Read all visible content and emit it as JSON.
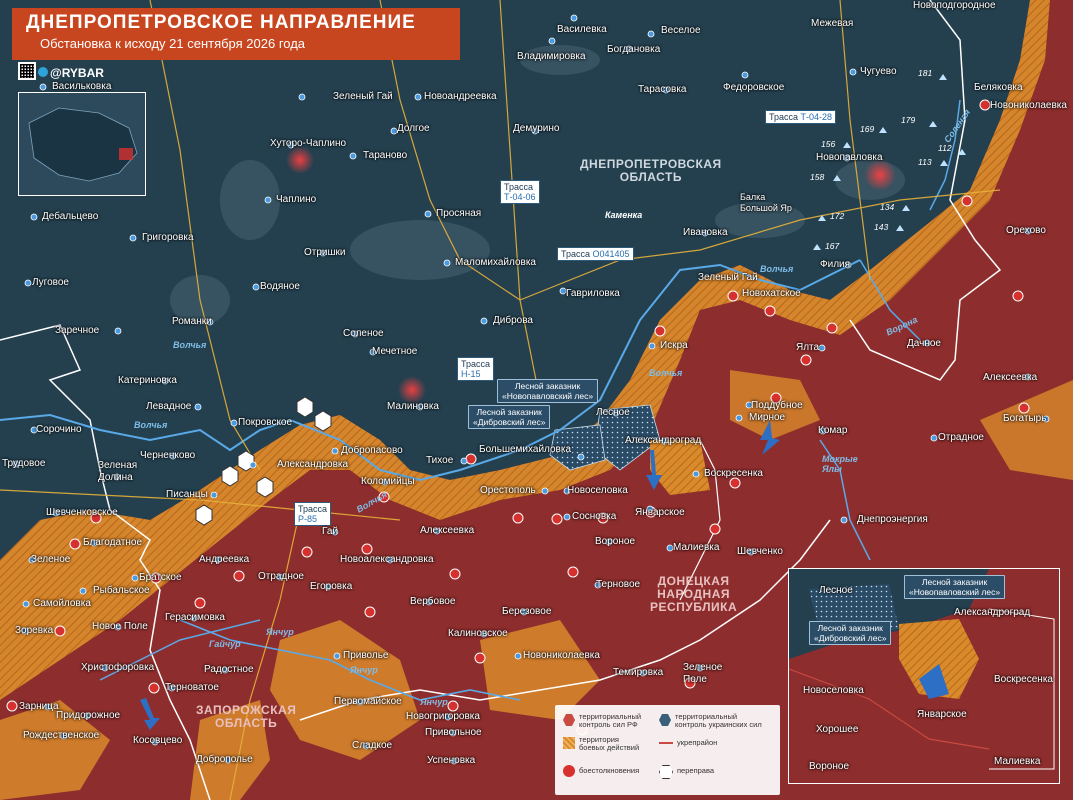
{
  "header": {
    "title": "ДНЕПРОПЕТРОВСКОЕ НАПРАВЛЕНИЕ",
    "subtitle": "Обстановка к исходу 21 сентября 2026 года",
    "brand": "@RYBAR"
  },
  "colors": {
    "russian_control": "#8e2d2d",
    "combat_zone": "#d98a2b",
    "ukrainian_control": "#1f3a4a",
    "front_line": "#ffffff",
    "clash": "#d32d2d"
  },
  "regions": {
    "dnepr": "ДНЕПРОПЕТРОВСКАЯ\nОБЛАСТЬ",
    "donetsk": "ДОНЕЦКАЯ\nНАРОДНАЯ\nРЕСПУБЛИКА",
    "zaporozhye": "ЗАПОРОЖСКАЯ\nОБЛАСТЬ"
  },
  "roads": {
    "t0428_prefix": "Трасса ",
    "t0428": "Т-04-28",
    "t0406_prefix": "Трасса",
    "t0406": "Т-04-06",
    "o041405_prefix": "Трасса ",
    "o041405": "О041405",
    "h15_prefix": "Трасса",
    "h15": "Н-15",
    "p85_prefix": "Трасса",
    "p85": "Р-85"
  },
  "rivers": {
    "volchya1": "Волчья",
    "volchya2": "Волчья",
    "volchya3": "Волчья",
    "volchya4": "Волчья",
    "volchya5": "Волчья",
    "yanchur1": "Янчур",
    "yanchur2": "Янчур",
    "yanchur3": "Янчур",
    "gaichur": "Гайчур",
    "vornaya": "Ворона",
    "solenaya": "Соленая",
    "mokrye_yaly": "Мокрые\nЯлы",
    "kamenka": "Каменка"
  },
  "towns": {
    "novopodgorodnoe": "Новоподгородное",
    "mezhevaya": "Межевая",
    "vasilevka_n": "Василевка",
    "veseloe": "Веселое",
    "vladimirovka": "Владимировка",
    "bogdanovka": "Богдановка",
    "vasilkovka": "Васильковка",
    "chuguevo": "Чугуево",
    "belyakovka": "Беляковка",
    "novonikolaevka_ne": "Новониколаевка",
    "zeleny_gai_n": "Зеленый Гай",
    "novoandreevka": "Новоандреевка",
    "tarasovka": "Тарасовка",
    "fedorovskoe": "Федоровское",
    "dolgoe": "Долгое",
    "demurino": "Демурино",
    "khutoro_chaplino": "Хуторо-Чаплино",
    "taranovo": "Тараново",
    "novopavlovka": "Новопавловка",
    "chaplino": "Чаплино",
    "debaltsevo": "Дебальцево",
    "grigorovka": "Григоровка",
    "prosyanaya": "Просяная",
    "balka_bolshoy_yar": "Балка\nБольшой Яр",
    "ivanovka": "Ивановка",
    "orekhovo": "Орехово",
    "otrishki": "Отришки",
    "malomikhailovka": "Маломихайловка",
    "filia": "Филия",
    "lugovoe": "Луговое",
    "vodyanoe": "Водяное",
    "gavrilovka": "Гавриловка",
    "zeleny_gai_c": "Зеленый Гай",
    "novokhatskoe": "Новохатское",
    "zarechnoe": "Заречное",
    "romanki": "Романки",
    "dibrova": "Диброва",
    "yalta": "Ялта",
    "dachnoe": "Дачное",
    "solenoe": "Соленое",
    "iskra": "Искра",
    "mechetnoe": "Мечетное",
    "alekseevka_e": "Алексеевка",
    "katerinovka": "Катериновка",
    "poddubnoe": "Поддубное",
    "mirnoe": "Мирное",
    "levadnoe": "Левадное",
    "malinovka": "Малиновка",
    "bogatyr": "Богатырь",
    "lesnoe": "Лесное",
    "sorochino": "Сорочино",
    "pokrovskoe": "Покровское",
    "dobropasovo": "Добропасово",
    "komar": "Комар",
    "aleksandrograd": "Александроград",
    "otradnoe_e": "Отрадное",
    "chernenkovo": "Черненково",
    "aleksandrovka": "Александровка",
    "tikhoe": "Тихое",
    "bolshemikhailovka": "Большемихайловка",
    "trudovoe": "Трудовое",
    "zelenaya_dolina": "Зеленая\nДолина",
    "kolomiytsy": "Коломийцы",
    "voskresenka": "Воскресенка",
    "pisantsy": "Писанцы",
    "orestopol": "Орестополь",
    "novoselovka": "Новоселовка",
    "shevchenkovskoe": "Шевченковское",
    "yanvarskoe": "Январское",
    "sosnovka": "Сосновка",
    "dneproenergia": "Днепроэнергия",
    "blagodatnoe": "Благодатное",
    "gai": "Гай",
    "alekseevka_s": "Алексеевка",
    "voronoe": "Вороное",
    "malievka": "Малиевка",
    "zelenoe": "Зеленое",
    "andreevka": "Андреевка",
    "novoaleksandrovka": "Новоалександровка",
    "shevchenko": "Шевченко",
    "bratskoe": "Братское",
    "otradnoe_w": "Отрадное",
    "rybalskoe": "Рыбальское",
    "samoylovka": "Самойловка",
    "egorovka": "Егоровка",
    "terновое": "Терновое",
    "verbovoe": "Вербовое",
    "berezovoe": "Березовое",
    "gerasimovka": "Герасимовка",
    "zorevka": "Зоревка",
    "novoe_pole": "Новое Поле",
    "kalinovskoe": "Калиновское",
    "novonikolaevka_s": "Новониколаевка",
    "khristoforovka": "Христофоровка",
    "privolnoe": "Приволье",
    "radostnoe": "Радостное",
    "temirovka": "Темировка",
    "zelenoe_pole": "Зеленое\nПоле",
    "ternovatoe": "Терноватое",
    "zarnitsa": "Зарница",
    "pridorozhnoe": "Придорожное",
    "pervomayskoe": "Первомайское",
    "novogrigorovka": "Новогригоровка",
    "rozhdestvenskoe": "Рождественское",
    "kosovtsevo": "Косовцево",
    "privolnoe_s": "Привольное",
    "sladkoe": "Сладкое",
    "dobropolie": "Доброполье",
    "uspenovka": "Успеновка"
  },
  "forests": {
    "novopavlovsky": "Лесной заказник\n«Новопавловский лес»",
    "dibrovsky": "Лесной заказник\n«Дибровский лес»"
  },
  "heights": [
    "181",
    "179",
    "169",
    "156",
    "112",
    "113",
    "158",
    "134",
    "172",
    "143",
    "167"
  ],
  "inset": {
    "lesnoe": "Лесное",
    "aleksandrograd": "Александроград",
    "voskresenka": "Воскресенка",
    "novoselovka": "Новоселовка",
    "yanvarskoe": "Январское",
    "khoroshee": "Хорошее",
    "voronoe": "Вороное",
    "malievka": "Малиевка",
    "forest_n": "Лесной заказник\n«Новопавловский лес»",
    "forest_d": "Лесной заказник\n«Дибровский лес»"
  },
  "legend": {
    "rf": "территориальный\nконтроль сил РФ",
    "ua": "территориальный\nконтроль украинских сил",
    "combat": "территория\nбоевых действий",
    "fort": "укрепрайон",
    "clash": "боестолкновения",
    "crossing": "переправа"
  }
}
